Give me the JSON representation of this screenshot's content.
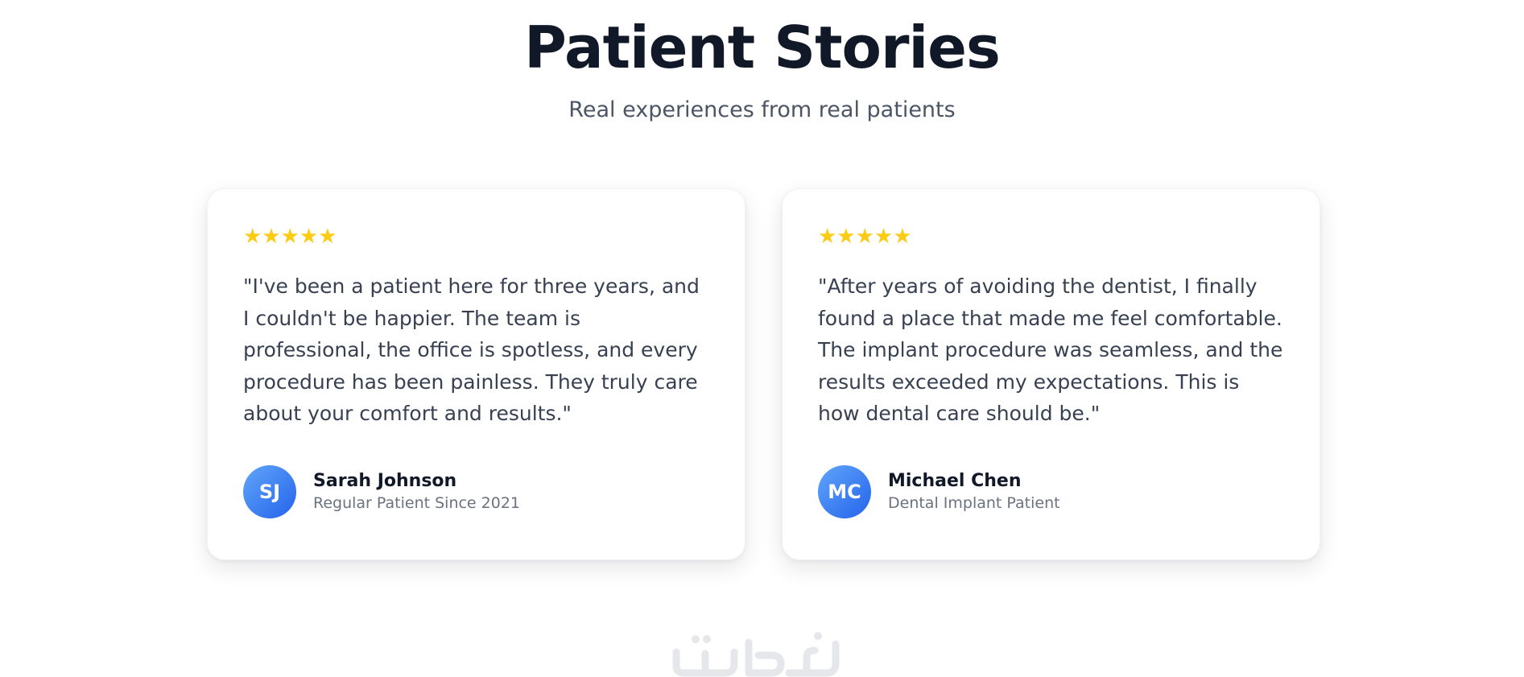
{
  "header": {
    "title": "Patient Stories",
    "subtitle": "Real experiences from real patients"
  },
  "testimonials": [
    {
      "rating": 5,
      "stars": "★★★★★",
      "quote": "\"I've been a patient here for three years, and I couldn't be happier. The team is professional, the office is spotless, and every procedure has been painless. They truly care about your comfort and results.\"",
      "initials": "SJ",
      "name": "Sarah Johnson",
      "role": "Regular Patient Since 2021"
    },
    {
      "rating": 5,
      "stars": "★★★★★",
      "quote": "\"After years of avoiding the dentist, I finally found a place that made me feel comfortable. The implant procedure was seamless, and the results exceeded my expectations. This is how dental care should be.\"",
      "initials": "MC",
      "name": "Michael Chen",
      "role": "Dental Implant Patient"
    }
  ],
  "watermark": {
    "text": "خمسات"
  },
  "colors": {
    "title": "#111827",
    "subtitle": "#4b5563",
    "star": "#facc15",
    "quote": "#374151",
    "avatar_start": "#60a5fa",
    "avatar_end": "#2563eb",
    "role": "#6b7280",
    "watermark": "#e5e7eb"
  },
  "icons": {
    "star": "star-icon"
  }
}
